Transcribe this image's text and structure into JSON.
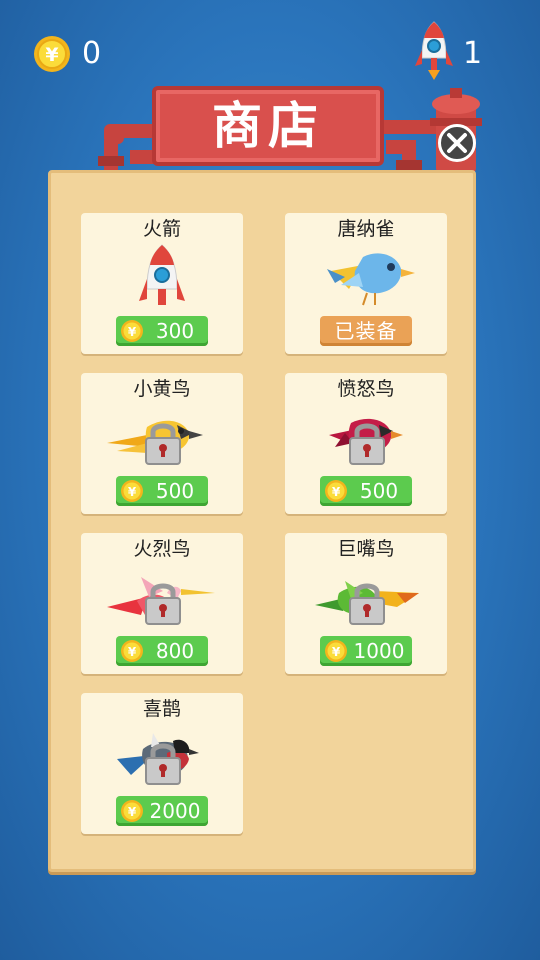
{
  "hud": {
    "coin_count": "0",
    "rocket_count": "1",
    "coin_icon": "yuan-coin-icon",
    "rocket_icon": "rocket-icon"
  },
  "header": {
    "title": "商店",
    "close_icon": "close-icon"
  },
  "colors": {
    "background": "#2a74bb",
    "panel": "#f2d49b",
    "card": "#fdf5dd",
    "sign_red": "#d9504d",
    "price_green": "#5ccb4e",
    "equipped_orange": "#eaa256"
  },
  "items": [
    {
      "name": "火箭",
      "price": "300",
      "status": "buy",
      "icon": "rocket-icon"
    },
    {
      "name": "唐纳雀",
      "equipped_label": "已装备",
      "status": "equipped",
      "icon": "blue-bird-icon"
    },
    {
      "name": "小黄鸟",
      "price": "500",
      "status": "locked",
      "icon": "yellow-bird-icon"
    },
    {
      "name": "愤怒鸟",
      "price": "500",
      "status": "locked",
      "icon": "red-bird-icon"
    },
    {
      "name": "火烈鸟",
      "price": "800",
      "status": "locked",
      "icon": "flamingo-bird-icon"
    },
    {
      "name": "巨嘴鸟",
      "price": "1000",
      "status": "locked",
      "icon": "toucan-bird-icon"
    },
    {
      "name": "喜鹊",
      "price": "2000",
      "status": "locked",
      "icon": "magpie-bird-icon"
    }
  ]
}
